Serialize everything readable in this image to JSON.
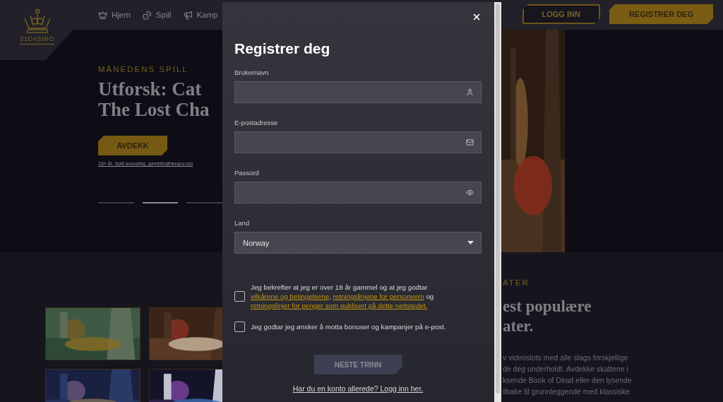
{
  "header": {
    "logo": "21CASINO",
    "nav": [
      {
        "label": "Hjem"
      },
      {
        "label": "Spill"
      },
      {
        "label": "Kamp"
      }
    ],
    "auth_buttons": [
      {
        "label": "LOGG INN",
        "kind": "outline"
      },
      {
        "label": "REGISTRER DEG",
        "kind": "filled"
      }
    ]
  },
  "hero": {
    "eyebrow": "MÅNEDENS SPILL",
    "title_lines": [
      "Utforsk: Cat",
      "The Lost Cha"
    ],
    "button": "AVDEKK",
    "disclaimer": "18+ år. Spill ansvarlig, gamblingtherapy.org",
    "slides": [
      {
        "selected": false
      },
      {
        "selected": true
      },
      {
        "selected": false
      }
    ]
  },
  "games_section": {
    "eyebrow": "ATER",
    "title_lines": [
      "est populære",
      "ater."
    ],
    "paragraph_lines": [
      "v videoslots med alle slags forskjellige",
      "de deg underholdt. Avdekke skattene i",
      "ksende Book of Dead eller den lysende",
      "ilbake til grunnleggende med klassiske"
    ],
    "games": [
      {
        "kind": "picture"
      },
      {
        "kind": "picture"
      },
      {
        "kind": "picture"
      },
      {
        "kind": "picture"
      }
    ]
  },
  "modal": {
    "title": "Registrer deg",
    "fields": [
      {
        "label": "Brukernavn",
        "kind": "text"
      },
      {
        "label": "E-postadresse",
        "kind": "email"
      },
      {
        "label": "Passord",
        "kind": "password"
      }
    ],
    "country": {
      "label": "Land",
      "value": "Norway"
    },
    "consents": [
      {
        "checked": false,
        "segments": [
          {
            "text": "Jeg bekrefter at jeg er over 18 år gammel og at jeg godtar ",
            "link": false
          },
          {
            "text": "vilkårene og betingelsene",
            "link": true
          },
          {
            "text": ", ",
            "link": false
          },
          {
            "text": "retningslinjene for personvern",
            "link": true
          },
          {
            "text": " og ",
            "link": false
          },
          {
            "text": "retningslinjer for penger som publisert på dette nettstedet.",
            "link": true
          }
        ]
      },
      {
        "checked": false,
        "segments": [
          {
            "text": "Jeg godtar jeg ønsker å motta bonuser og kampanjer på e-post.",
            "link": false
          }
        ]
      }
    ],
    "submit": {
      "label": "NESTE TRINN",
      "disabled": true
    },
    "login_link": "Har du en konto allerede? Logg inn her."
  }
}
